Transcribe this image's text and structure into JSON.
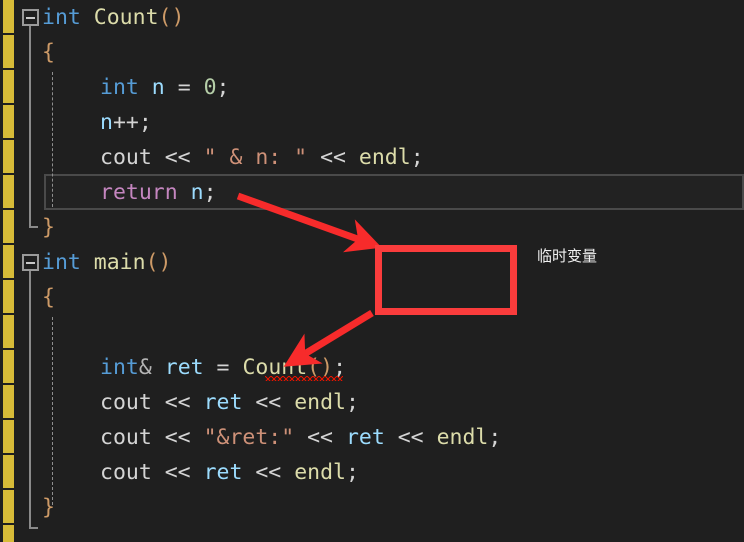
{
  "editor": {
    "background": "#1f1f1f",
    "gutter_change_color": "#d7bb38",
    "current_line_border": "#4a4a4a",
    "language": "C++"
  },
  "code": {
    "lines": [
      {
        "index": 1,
        "fold": "collapse-minus",
        "tokens": [
          {
            "text": "int",
            "style": "t-kw"
          },
          {
            "text": " ",
            "style": "t-plain"
          },
          {
            "text": "Count",
            "style": "t-fn"
          },
          {
            "text": "()",
            "style": "t-paren"
          }
        ]
      },
      {
        "index": 2,
        "fold": "",
        "tokens": [
          {
            "text": "{",
            "style": "t-brace"
          }
        ]
      },
      {
        "index": 3,
        "fold": "",
        "tokens": [
          {
            "text": "int",
            "style": "t-kw"
          },
          {
            "text": " ",
            "style": "t-plain"
          },
          {
            "text": "n",
            "style": "t-var"
          },
          {
            "text": " = ",
            "style": "t-plain"
          },
          {
            "text": "0",
            "style": "t-num"
          },
          {
            "text": ";",
            "style": "t-punct"
          }
        ]
      },
      {
        "index": 4,
        "fold": "",
        "tokens": [
          {
            "text": "n",
            "style": "t-var"
          },
          {
            "text": "++;",
            "style": "t-plain"
          }
        ]
      },
      {
        "index": 5,
        "fold": "",
        "tokens": [
          {
            "text": "cout",
            "style": "t-plain"
          },
          {
            "text": " << ",
            "style": "t-plain"
          },
          {
            "text": "\" & n: \"",
            "style": "t-str"
          },
          {
            "text": " << ",
            "style": "t-plain"
          },
          {
            "text": "endl",
            "style": "t-fn"
          },
          {
            "text": ";",
            "style": "t-punct"
          }
        ]
      },
      {
        "index": 6,
        "fold": "",
        "current": true,
        "tokens": [
          {
            "text": "return",
            "style": "t-ctrl"
          },
          {
            "text": " ",
            "style": "t-plain"
          },
          {
            "text": "n",
            "style": "t-var"
          },
          {
            "text": ";",
            "style": "t-punct"
          }
        ]
      },
      {
        "index": 7,
        "fold": "",
        "tokens": [
          {
            "text": "}",
            "style": "t-brace"
          }
        ]
      },
      {
        "index": 8,
        "fold": "collapse-minus",
        "tokens": [
          {
            "text": "int",
            "style": "t-kw"
          },
          {
            "text": " ",
            "style": "t-plain"
          },
          {
            "text": "main",
            "style": "t-fn"
          },
          {
            "text": "()",
            "style": "t-paren"
          }
        ]
      },
      {
        "index": 9,
        "fold": "",
        "tokens": [
          {
            "text": "{",
            "style": "t-brace"
          }
        ]
      },
      {
        "index": 10,
        "fold": "",
        "tokens": []
      },
      {
        "index": 11,
        "fold": "",
        "error_squiggle": true,
        "tokens": [
          {
            "text": "int",
            "style": "t-kw"
          },
          {
            "text": "&",
            "style": "t-amp"
          },
          {
            "text": " ",
            "style": "t-plain"
          },
          {
            "text": "ret",
            "style": "t-var"
          },
          {
            "text": " = ",
            "style": "t-plain"
          },
          {
            "text": "Count",
            "style": "t-fn"
          },
          {
            "text": "()",
            "style": "t-paren"
          },
          {
            "text": ";",
            "style": "t-punct"
          }
        ]
      },
      {
        "index": 12,
        "fold": "",
        "tokens": [
          {
            "text": "cout",
            "style": "t-plain"
          },
          {
            "text": " << ",
            "style": "t-plain"
          },
          {
            "text": "ret",
            "style": "t-var"
          },
          {
            "text": " << ",
            "style": "t-plain"
          },
          {
            "text": "endl",
            "style": "t-fn"
          },
          {
            "text": ";",
            "style": "t-punct"
          }
        ]
      },
      {
        "index": 13,
        "fold": "",
        "tokens": [
          {
            "text": "cout",
            "style": "t-plain"
          },
          {
            "text": " << ",
            "style": "t-plain"
          },
          {
            "text": "\"&ret:\"",
            "style": "t-str"
          },
          {
            "text": " << ",
            "style": "t-plain"
          },
          {
            "text": "ret",
            "style": "t-var"
          },
          {
            "text": " << ",
            "style": "t-plain"
          },
          {
            "text": "endl",
            "style": "t-fn"
          },
          {
            "text": ";",
            "style": "t-punct"
          }
        ]
      },
      {
        "index": 14,
        "fold": "",
        "tokens": [
          {
            "text": "cout",
            "style": "t-plain"
          },
          {
            "text": " << ",
            "style": "t-plain"
          },
          {
            "text": "ret",
            "style": "t-var"
          },
          {
            "text": " << ",
            "style": "t-plain"
          },
          {
            "text": "endl",
            "style": "t-fn"
          },
          {
            "text": ";",
            "style": "t-punct"
          }
        ]
      },
      {
        "index": 15,
        "fold": "",
        "tokens": [
          {
            "text": "}",
            "style": "t-brace"
          }
        ]
      }
    ]
  },
  "annotations": {
    "box_color": "#fa3c3c",
    "arrow_color": "#f72b2b",
    "label": "临时变量",
    "arrows": [
      {
        "name": "arrow-return-to-box",
        "from": "return n;",
        "to": "temp-variable-box"
      },
      {
        "name": "arrow-box-to-count",
        "from": "temp-variable-box",
        "to": "Count()"
      }
    ]
  }
}
